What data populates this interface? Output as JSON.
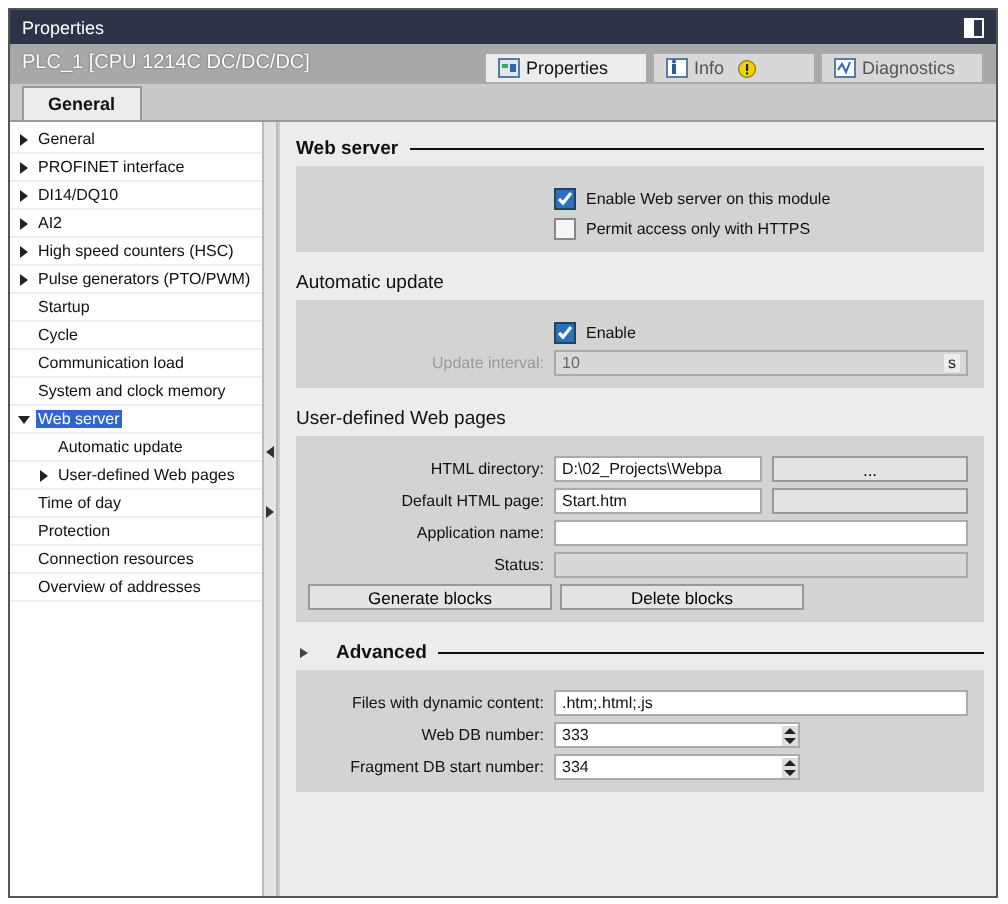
{
  "window": {
    "title": "Properties"
  },
  "device": "PLC_1 [CPU 1214C DC/DC/DC]",
  "view_tabs": [
    {
      "label": "Properties",
      "selected": true
    },
    {
      "label": "Info",
      "warning": true,
      "selected": false
    },
    {
      "label": "Diagnostics",
      "selected": false
    }
  ],
  "sub_tabs": [
    {
      "label": "General",
      "selected": true
    }
  ],
  "tree": [
    {
      "label": "General",
      "expanded": false,
      "selected": false
    },
    {
      "label": "PROFINET interface",
      "expanded": false,
      "selected": false
    },
    {
      "label": "DI14/DQ10",
      "expanded": false,
      "selected": false
    },
    {
      "label": "AI2",
      "expanded": false,
      "selected": false
    },
    {
      "label": "High speed counters (HSC)",
      "expanded": false,
      "selected": false
    },
    {
      "label": "Pulse generators (PTO/PWM)",
      "expanded": false,
      "selected": false
    },
    {
      "label": "Startup",
      "selected": false
    },
    {
      "label": "Cycle",
      "selected": false
    },
    {
      "label": "Communication load",
      "selected": false
    },
    {
      "label": "System and clock memory",
      "selected": false
    },
    {
      "label": "Web server",
      "expanded": true,
      "selected": true,
      "children": [
        {
          "label": "Automatic update",
          "selected": false
        },
        {
          "label": "User-defined Web pages",
          "expanded": false,
          "selected": false
        }
      ]
    },
    {
      "label": "Time of day",
      "selected": false
    },
    {
      "label": "Protection",
      "selected": false
    },
    {
      "label": "Connection resources",
      "selected": false
    },
    {
      "label": "Overview of addresses",
      "selected": false
    }
  ],
  "sections": [
    {
      "title": "Web server",
      "kind": "group",
      "rows": [
        {
          "kind": "checkbox",
          "label": "Enable Web server on this module",
          "checked": true
        },
        {
          "kind": "checkbox",
          "label": "Permit access only with HTTPS",
          "checked": false
        }
      ]
    },
    {
      "title": "Automatic update",
      "kind": "subgroup",
      "rows": [
        {
          "kind": "checkbox",
          "label": "Enable",
          "checked": true
        },
        {
          "kind": "unit",
          "label": "Update interval:",
          "value": "10",
          "unit": "s",
          "disabled": true
        }
      ]
    },
    {
      "title": "User-defined Web pages",
      "kind": "subgroup",
      "rows": [
        {
          "kind": "browse",
          "label": "HTML directory:",
          "value": "D:\\02_Projects\\Webpa",
          "button": "...",
          "disabled": false
        },
        {
          "kind": "browse",
          "label": "Default HTML page:",
          "value": "Start.htm",
          "button": "",
          "disabled": false
        },
        {
          "kind": "text",
          "label": "Application name:",
          "value": "",
          "disabled": false
        },
        {
          "kind": "text",
          "label": "Status:",
          "value": "",
          "disabled": true
        },
        {
          "kind": "buttons",
          "buttons": [
            "Generate blocks",
            "Delete blocks"
          ]
        }
      ]
    },
    {
      "title": "Advanced",
      "kind": "expandable",
      "rows": [
        {
          "kind": "text",
          "label": "Files with dynamic content:",
          "value": ".htm;.html;.js",
          "disabled": false
        },
        {
          "kind": "spin",
          "label": "Web DB number:",
          "value": "333"
        },
        {
          "kind": "spin",
          "label": "Fragment DB start number:",
          "value": "334"
        }
      ]
    }
  ]
}
